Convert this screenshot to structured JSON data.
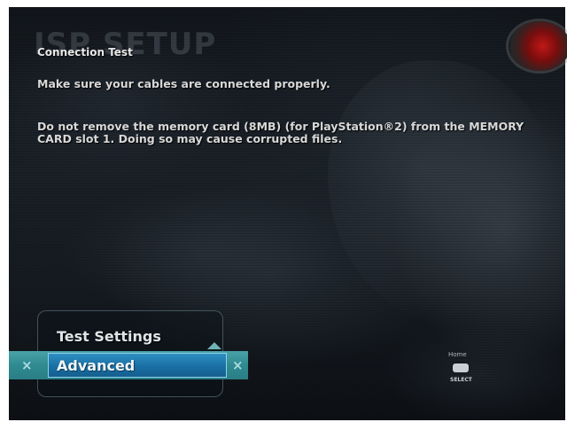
{
  "screen": {
    "background_title": "ISP SETUP",
    "heading": "Connection Test",
    "message_1": "Make sure your cables are connected properly.",
    "message_2": "Do not remove the memory card (8MB) (for PlayStation®2) from the MEMORY CARD slot 1. Doing so may cause corrupted files."
  },
  "menu": {
    "items": [
      {
        "label": "Test Settings",
        "selected": false
      },
      {
        "label": "Advanced",
        "selected": true
      }
    ],
    "confirm_glyph": "×"
  },
  "footer": {
    "home_label": "Home",
    "select_label": "SELECT"
  },
  "colors": {
    "selection_bar": "#2f8a91",
    "selection_highlight": "#1a6fa4",
    "text": "#e8e8e8",
    "orb": "#c01818"
  }
}
